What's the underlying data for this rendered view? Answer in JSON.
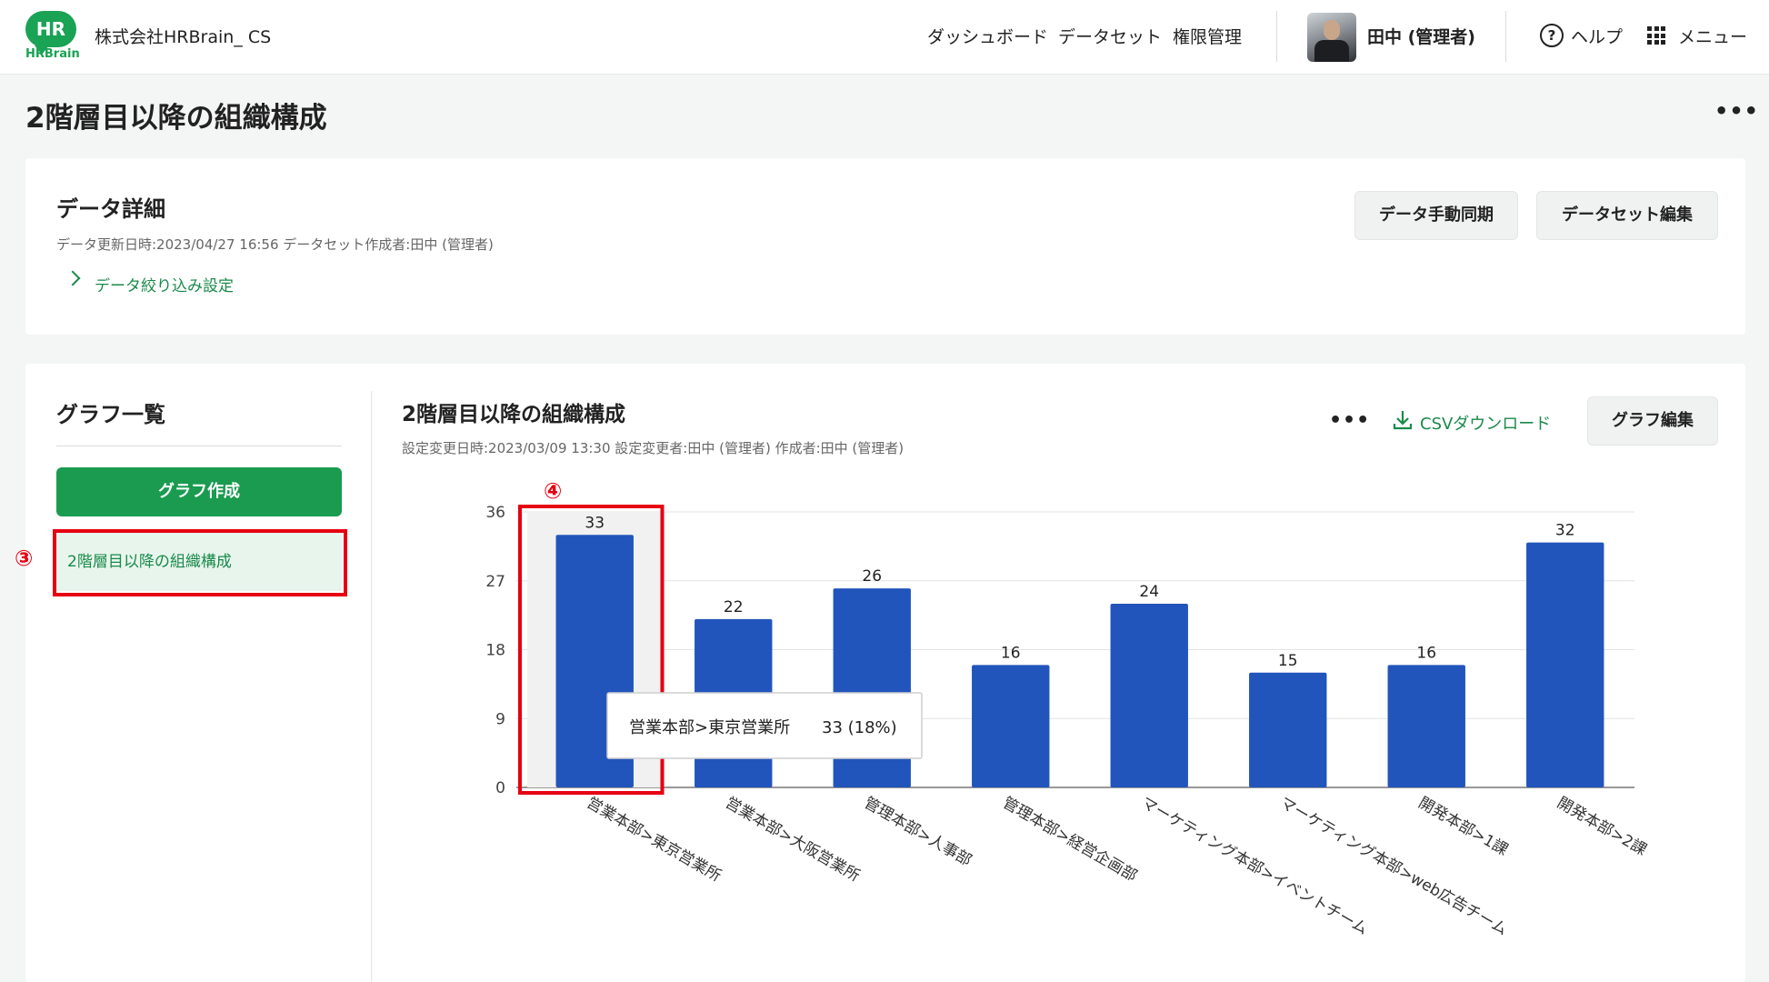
{
  "header": {
    "logo_text": "HR",
    "logo_brand": "HRBrain",
    "company": "株式会社HRBrain_ CS",
    "nav": [
      "ダッシュボード",
      "データセット",
      "権限管理"
    ],
    "user_name": "田中 (管理者)",
    "help_glyph": "?",
    "help_label": "ヘルプ",
    "menu_label": "メニュー"
  },
  "page": {
    "title": "2階層目以降の組織構成",
    "more": "•••"
  },
  "data_detail": {
    "title": "データ詳細",
    "meta": "データ更新日時:2023/04/27 16:56 データセット作成者:田中 (管理者)",
    "filter_link": "データ絞り込み設定",
    "sync_button": "データ手動同期",
    "dataset_edit_button": "データセット編集"
  },
  "graph_list": {
    "title": "グラフ一覧",
    "create_button": "グラフ作成",
    "items": [
      "2階層目以降の組織構成"
    ],
    "marker": "③"
  },
  "graph": {
    "title": "2階層目以降の組織構成",
    "meta": "設定変更日時:2023/03/09 13:30 設定変更者:田中 (管理者) 作成者:田中 (管理者)",
    "more": "•••",
    "csv_label": "CSVダウンロード",
    "edit_button": "グラフ編集",
    "marker": "④",
    "tooltip": {
      "label": "営業本部>東京営業所",
      "value": "33 (18%)"
    }
  },
  "chart_data": {
    "type": "bar",
    "categories": [
      "営業本部>東京営業所",
      "営業本部>大阪営業所",
      "管理本部>人事部",
      "管理本部>経営企画部",
      "マーケティング本部>イベントチーム",
      "マーケティング本部>web広告チーム",
      "開発本部>1課",
      "開発本部>2課"
    ],
    "values": [
      33,
      22,
      26,
      16,
      24,
      15,
      16,
      32
    ],
    "yticks": [
      "0",
      "9",
      "18",
      "27",
      "36"
    ],
    "ylim": [
      0,
      36
    ],
    "grid": true,
    "highlighted_index": 0,
    "bar_color": "#2255bb"
  }
}
